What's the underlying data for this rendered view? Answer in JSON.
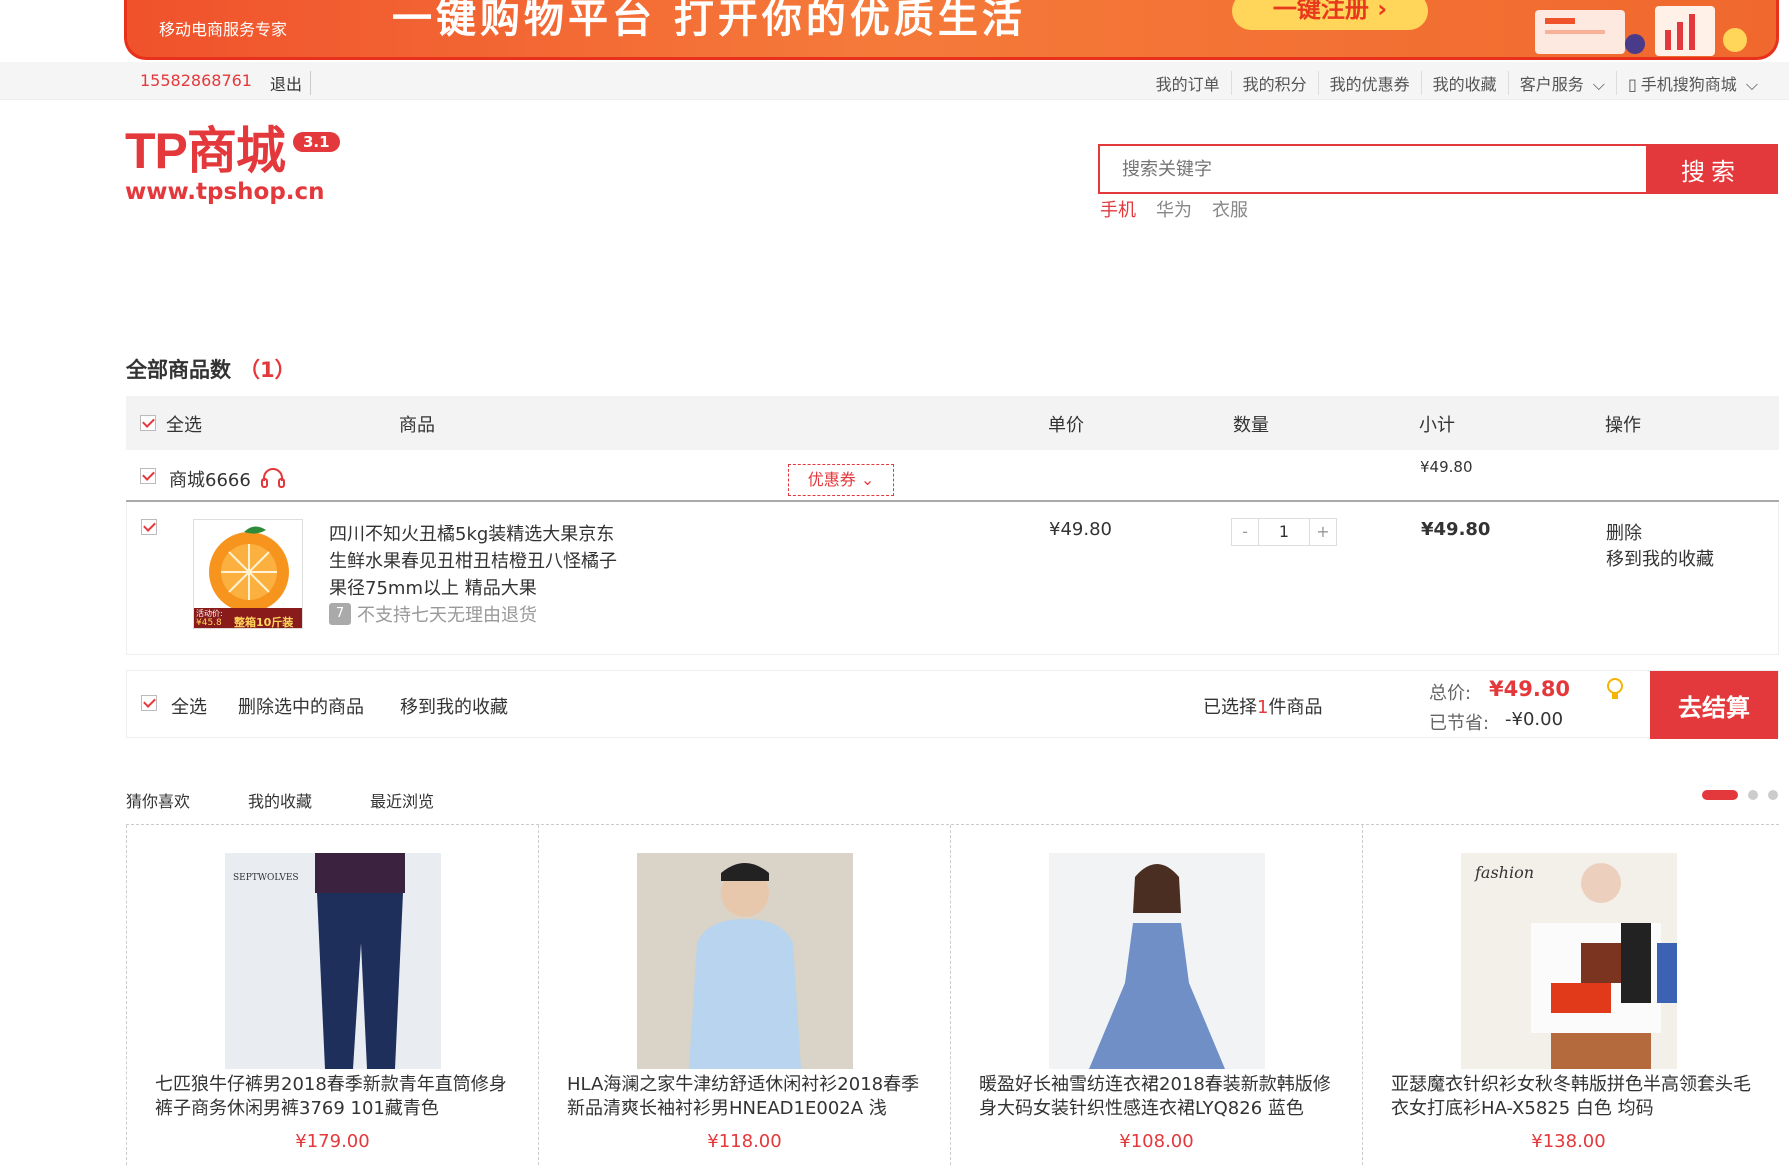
{
  "banner": {
    "subtitle": "移动电商服务专家",
    "slogan": "一键购物平台 打开你的优质生活",
    "register_label": "一键注册 ›"
  },
  "topbar": {
    "phone": "15582868761",
    "logout": "退出",
    "links": [
      "我的订单",
      "我的积分",
      "我的优惠券",
      "我的收藏",
      "客户服务",
      "手机搜狗商城"
    ]
  },
  "logo": {
    "name": "TP商城",
    "version": "3.1",
    "url": "www.tpshop.cn"
  },
  "search": {
    "placeholder": "搜索关键字",
    "button": "搜索",
    "hot_words": [
      "手机",
      "华为",
      "衣服"
    ]
  },
  "cart": {
    "count_label": "全部商品数",
    "count": "（1）",
    "headers": {
      "select_all": "全选",
      "product": "商品",
      "unit_price": "单价",
      "quantity": "数量",
      "subtotal": "小计",
      "actions": "操作"
    },
    "shop": {
      "name": "商城6666",
      "coupon": "优惠券",
      "subtotal": "¥49.80"
    },
    "item": {
      "name": "四川不知火丑橘5kg装精选大果京东生鲜水果春见丑柑丑桔橙丑八怪橘子 果径75mm以上 精品大果",
      "no_return": "不支持七天无理由退货",
      "price": "¥49.80",
      "quantity": "1",
      "subtotal": "¥49.80",
      "delete": "删除",
      "move_fav": "移到我的收藏",
      "thumb_badge_price": "¥45.8",
      "thumb_badge_text": "整箱10斤装",
      "thumb_badge_top": "活动价:"
    },
    "footer": {
      "select_all": "全选",
      "delete_selected": "删除选中的商品",
      "move_fav": "移到我的收藏",
      "selected_prefix": "已选择",
      "selected_count": "1",
      "selected_suffix": "件商品",
      "total_label": "总价:",
      "total": "¥49.80",
      "saved_label": "已节省:",
      "saved": "-¥0.00",
      "checkout": "去结算"
    }
  },
  "recommend": {
    "tabs": [
      "猜你喜欢",
      "我的收藏",
      "最近浏览"
    ],
    "items": [
      {
        "name": "七匹狼牛仔裤男2018春季新款青年直筒修身裤子商务休闲男裤3769 101藏青色",
        "price": "¥179.00",
        "brand": "SEPTWOLVES"
      },
      {
        "name": "HLA海澜之家牛津纺舒适休闲衬衫2018春季新品清爽长袖衬衫男HNEAD1E002A 浅",
        "price": "¥118.00"
      },
      {
        "name": "暖盈好长袖雪纺连衣裙2018春装新款韩版修身大码女装针织性感连衣裙LYQ826 蓝色",
        "price": "¥108.00"
      },
      {
        "name": "亚瑟魔衣针织衫女秋冬韩版拼色半高领套头毛衣女打底衫HA-X5825 白色 均码",
        "price": "¥138.00",
        "tag": "fashion"
      }
    ]
  },
  "colors": {
    "brand_red": "#e4393c",
    "banner_orange": "#f57a3a",
    "register_yellow": "#ffd65a"
  }
}
